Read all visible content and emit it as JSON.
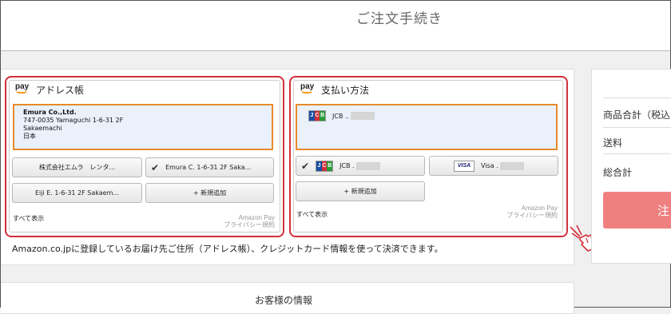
{
  "header": {
    "title": "ご注文手続き"
  },
  "address_widget": {
    "logo": "pay",
    "title": "アドレス帳",
    "selected": {
      "name": "Emura Co.,Ltd.",
      "line1": "747-0035 Yamaguchi 1-6-31 2F",
      "line2": "Sakaemachi",
      "line3": "日本"
    },
    "buttons": [
      {
        "label": "株式会社エムラ　レンタ..."
      },
      {
        "label": "Emura C. 1-6-31 2F Saka..."
      },
      {
        "label": "Eiji E. 1-6-31 2F Sakaem..."
      },
      {
        "label": "+ 新規追加"
      }
    ],
    "show_all": "すべて表示",
    "footer_brand": "Amazon Pay",
    "footer_link": "プライバシー規約"
  },
  "payment_widget": {
    "logo": "pay",
    "title": "支払い方法",
    "selected": {
      "card_brand": "JCB",
      "label": "JCB .."
    },
    "buttons": [
      {
        "card_brand": "JCB",
        "label": "JCB ."
      },
      {
        "card_brand": "VISA",
        "label": "Visa ."
      },
      {
        "label": "+ 新規追加"
      }
    ],
    "show_all": "すべて表示",
    "footer_brand": "Amazon Pay",
    "footer_link": "プライバシー規約"
  },
  "info_text": "Amazon.co.jpに登録しているお届け先ご住所（アドレス帳）、クレジットカード情報を使って決済できます。",
  "summary": {
    "subtotal_label": "商品合計（税込",
    "shipping_label": "送料",
    "total_label": "総合計",
    "order_button": "注"
  },
  "customer_section": {
    "title": "お客様の情報"
  },
  "colors": {
    "highlight": "#d32f3a",
    "selection_border": "#e88a2a",
    "order_button": "#f08080"
  },
  "icons": {
    "check": "check-icon",
    "cursor": "hand-pointer-icon"
  }
}
